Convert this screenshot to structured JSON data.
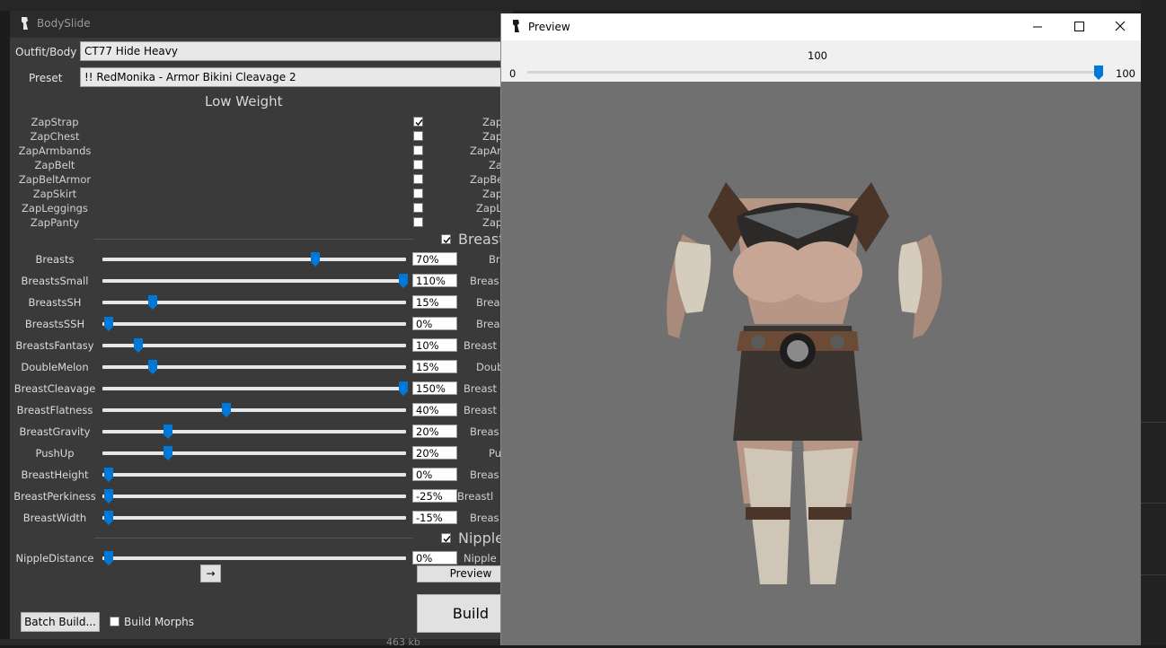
{
  "bodyslide": {
    "title": "BodySlide",
    "outfit_label": "Outfit/Body",
    "outfit_value": "CT77 Hide Heavy",
    "preset_label": "Preset",
    "preset_value": "!! RedMonika - Armor Bikini Cleavage 2",
    "section_title": "Low Weight",
    "zaps": [
      {
        "label": "ZapStrap",
        "right": "Zap",
        "checked": true
      },
      {
        "label": "ZapChest",
        "right": "Zap",
        "checked": false
      },
      {
        "label": "ZapArmbands",
        "right": "ZapAr",
        "checked": false
      },
      {
        "label": "ZapBelt",
        "right": "Za",
        "checked": false
      },
      {
        "label": "ZapBeltArmor",
        "right": "ZapBe",
        "checked": false
      },
      {
        "label": "ZapSkirt",
        "right": "Zap",
        "checked": false
      },
      {
        "label": "ZapLeggings",
        "right": "ZapL",
        "checked": false
      },
      {
        "label": "ZapPanty",
        "right": "Zap",
        "checked": false
      }
    ],
    "group_breasts": "Breast",
    "sliders": [
      {
        "label": "Breasts",
        "value_text": "70%",
        "value": 70,
        "right": "Br"
      },
      {
        "label": "BreastsSmall",
        "value_text": "110%",
        "value": 100,
        "right": "Breas"
      },
      {
        "label": "BreastsSH",
        "value_text": "15%",
        "value": 15,
        "right": "Brea"
      },
      {
        "label": "BreastsSSH",
        "value_text": "0%",
        "value": 0,
        "right": "Brea"
      },
      {
        "label": "BreastsFantasy",
        "value_text": "10%",
        "value": 10,
        "right": "Breast"
      },
      {
        "label": "DoubleMelon",
        "value_text": "15%",
        "value": 15,
        "right": "Doub"
      },
      {
        "label": "BreastCleavage",
        "value_text": "150%",
        "value": 100,
        "right": "Breast"
      },
      {
        "label": "BreastFlatness",
        "value_text": "40%",
        "value": 40,
        "right": "Breast"
      },
      {
        "label": "BreastGravity",
        "value_text": "20%",
        "value": 20,
        "right": "Breas"
      },
      {
        "label": "PushUp",
        "value_text": "20%",
        "value": 20,
        "right": "Pu"
      },
      {
        "label": "BreastHeight",
        "value_text": "0%",
        "value": 0,
        "right": "Breas"
      },
      {
        "label": "BreastPerkiness",
        "value_text": "-25%",
        "value": 0,
        "right": "Breastl"
      },
      {
        "label": "BreastWidth",
        "value_text": "-15%",
        "value": 0,
        "right": "Breas"
      }
    ],
    "group_nipples": "Nipple",
    "nipple_slider": {
      "label": "NippleDistance",
      "value_text": "0%",
      "value": 0,
      "right": "Nipple"
    },
    "arrow_label": "→",
    "preview_label": "Preview",
    "batch_label": "Batch Build...",
    "build_morphs_label": "Build Morphs",
    "build_label": "Build",
    "status_text": "463 kb"
  },
  "preview": {
    "title": "Preview",
    "slider_value": "100",
    "slider_min": "0",
    "slider_max": "100",
    "slider_fraction": 1.0
  }
}
